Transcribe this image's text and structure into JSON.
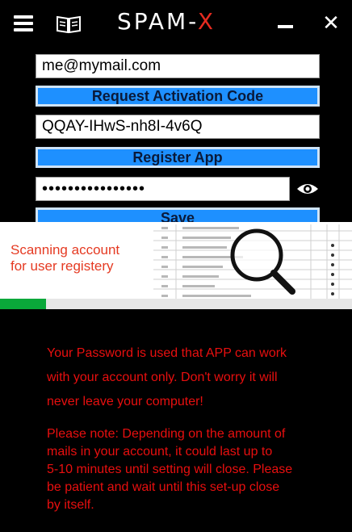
{
  "app": {
    "brand_main": "SPAM-",
    "brand_x": "X"
  },
  "titlebar": {
    "icons": [
      "menu-icon",
      "book-icon",
      "minimize-icon",
      "close-icon"
    ],
    "close_glyph": "✕"
  },
  "form": {
    "email_value": "me@mymail.com",
    "request_code_label": "Request Activation Code",
    "activation_code_value": "QQAY-IHwS-nh8I-4v6Q",
    "register_label": "Register App",
    "password_value": "••••••••••••••••",
    "save_label": "Save"
  },
  "banner": {
    "text_line1": "Scanning account",
    "text_line2": "for user registery",
    "progress_fraction": 0.13,
    "colors": {
      "text": "#e53a22",
      "progress": "#0aa83a"
    }
  },
  "notes": {
    "line1": "Your Password is used that APP can work",
    "line2": "with your account only. Don't worry it will",
    "line3": "never leave your computer!",
    "p2_line1": "Please note: Depending on the amount of",
    "p2_line2": "mails in your account, it could last up to",
    "p2_line3": "5-10 minutes until setting will close. Please",
    "p2_line4": "be patient and wait until this set-up close",
    "p2_line5": "by itself."
  },
  "colors": {
    "accent": "#1e90ff",
    "background": "#000000",
    "warning_text": "#e80f0f",
    "brand_x": "#e52b20"
  }
}
